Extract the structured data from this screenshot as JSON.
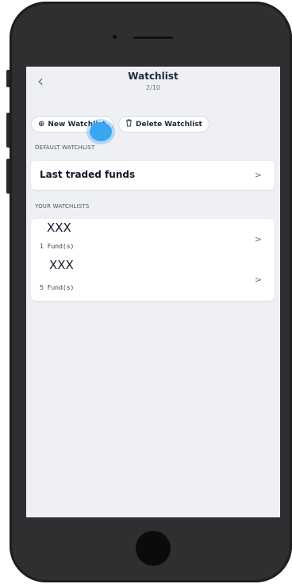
{
  "header": {
    "title": "Watchlist",
    "subtitle": "2/10",
    "back_icon": "chevron-left-icon"
  },
  "actions": {
    "new_label": "New Watchlist",
    "new_icon": "plus-circle-icon",
    "delete_label": "Delete Watchlist",
    "delete_icon": "trash-icon"
  },
  "default_section": {
    "label": "DEFAULT WATCHLIST",
    "item": "Last traded funds"
  },
  "your_section": {
    "label": "YOUR WATCHLISTS",
    "items": [
      {
        "name": "XXX",
        "count": "1 Fund(s)"
      },
      {
        "name": "XXX",
        "count": "5 Fund(s)"
      }
    ]
  },
  "colors": {
    "tap_indicator": "#3aa6f2",
    "screen_bg": "#eef0f4"
  }
}
